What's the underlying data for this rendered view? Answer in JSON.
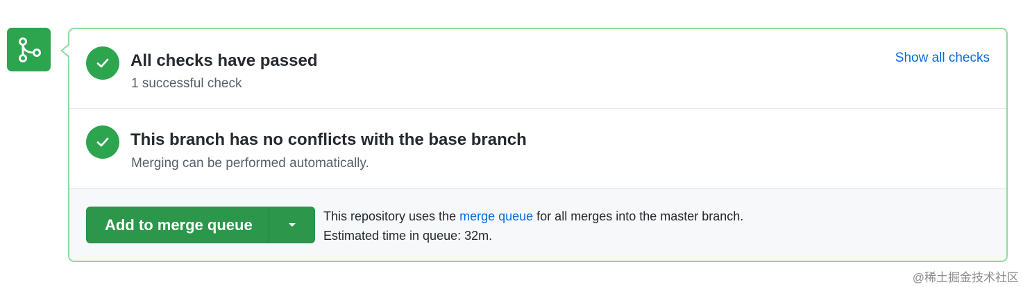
{
  "status": {
    "checks": {
      "title": "All checks have passed",
      "subtitle": "1 successful check",
      "link": "Show all checks"
    },
    "conflicts": {
      "title": "This branch has no conflicts with the base branch",
      "subtitle": "Merging can be performed automatically."
    }
  },
  "merge": {
    "button_label": "Add to merge queue",
    "info_prefix": "This repository uses the ",
    "info_link": "merge queue",
    "info_suffix": " for all merges into the master branch.",
    "estimate": "Estimated time in queue: 32m."
  },
  "icons": {
    "merge": "git-merge-icon",
    "check": "check-circle-icon",
    "dropdown": "triangle-down-icon"
  },
  "colors": {
    "success": "#2da44e",
    "link": "#0969da",
    "border": "#8ddb9d"
  },
  "watermark": "@稀土掘金技术社区"
}
